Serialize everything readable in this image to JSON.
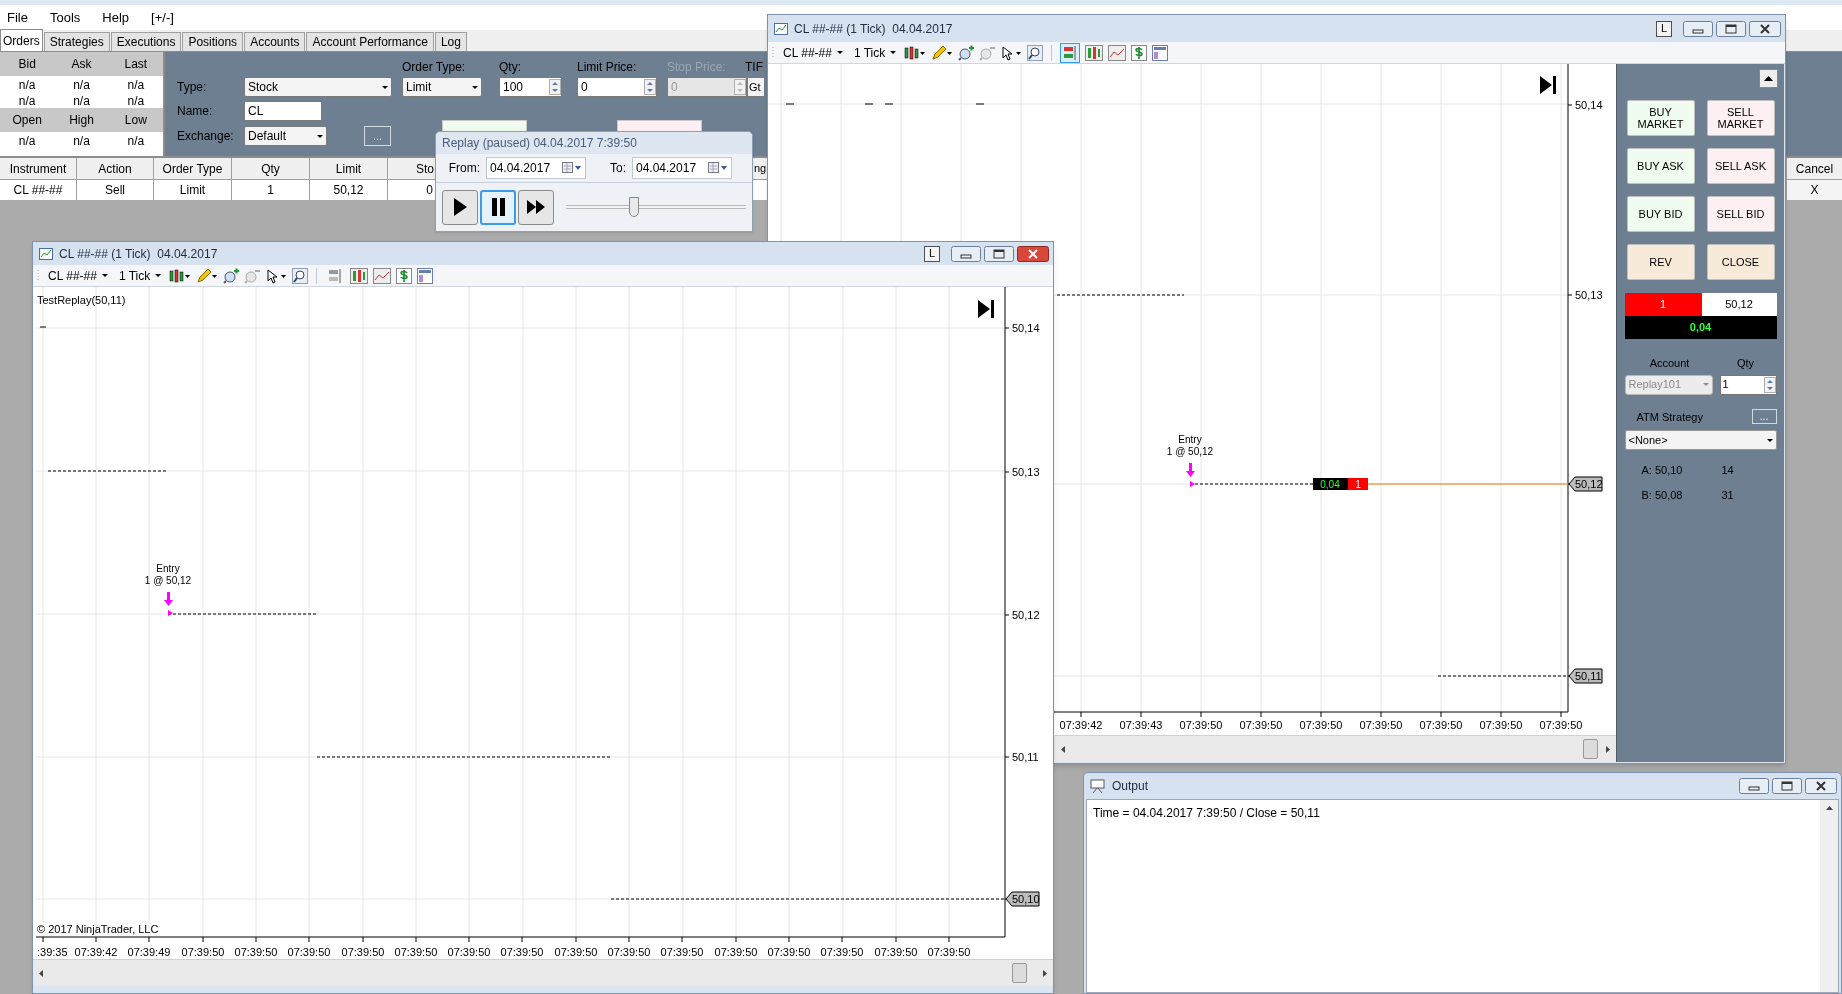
{
  "menu": [
    {
      "label": "File"
    },
    {
      "label": "Tools"
    },
    {
      "label": "Help"
    },
    {
      "label": "[+/-]"
    }
  ],
  "control_center": {
    "tabs": [
      {
        "label": "Orders",
        "selected": true
      },
      {
        "label": "Strategies",
        "selected": false
      },
      {
        "label": "Executions",
        "selected": false
      },
      {
        "label": "Positions",
        "selected": false
      },
      {
        "label": "Accounts",
        "selected": false
      },
      {
        "label": "Account Performance",
        "selected": false
      },
      {
        "label": "Log",
        "selected": false
      }
    ],
    "quotes": [
      {
        "kind": "header",
        "cells": [
          "Bid",
          "Ask",
          "Last"
        ]
      },
      {
        "kind": "values",
        "cells": [
          "n/a",
          "n/a",
          "n/a"
        ]
      },
      {
        "kind": "values",
        "cells": [
          "n/a",
          "n/a",
          "n/a"
        ]
      },
      {
        "kind": "header",
        "cells": [
          "Open",
          "High",
          "Low"
        ]
      },
      {
        "kind": "values",
        "cells": [
          "n/a",
          "n/a",
          "n/a"
        ]
      }
    ],
    "order_entry": {
      "type_label": "Type:",
      "type": "Stock",
      "name_label": "Name:",
      "name": "CL",
      "exchange_label": "Exchange:",
      "exchange": "Default",
      "more_button": "...",
      "order_type_label": "Order Type:",
      "order_type": "Limit",
      "qty_label": "Qty:",
      "qty": "100",
      "limit_price_label": "Limit Price:",
      "limit_price": "0",
      "stop_price_label": "Stop Price:",
      "stop_price": "0",
      "stop_price_disabled": true,
      "tif_label": "TIF",
      "tif": "Gt"
    },
    "orders_table": {
      "columns": [
        "Instrument",
        "Action",
        "Order Type",
        "Qty",
        "Limit",
        "Sto"
      ],
      "rows": [
        {
          "cells": [
            "CL ##-##",
            "Sell",
            "Limit",
            "1",
            "50,12",
            "0"
          ]
        }
      ],
      "column_partial": "ng",
      "cancel_column": {
        "header": "Cancel",
        "cell": "X"
      }
    }
  },
  "replay": {
    "title": "Replay (paused) 04.04.2017 7:39:50",
    "from_label": "From:",
    "from": "04.04.2017",
    "to_label": "To:",
    "to": "04.04.2017",
    "controls": [
      {
        "kind": "play",
        "selected": false
      },
      {
        "kind": "pause",
        "selected": true
      },
      {
        "kind": "fast_forward",
        "selected": false
      }
    ],
    "level": 0.38
  },
  "charts": [
    {
      "title": "CL ##-## (1 Tick)  04.04.2017",
      "lock_button": "L",
      "active": false,
      "instrument": "CL ##-##",
      "interval": "1 Tick",
      "chart_trader_selected": true,
      "price_labels": [
        {
          "text": "50,14",
          "kind": "plain"
        },
        {
          "text": "50,13",
          "kind": "plain"
        },
        {
          "text": "50,12",
          "kind": "marker"
        },
        {
          "text": "50,11",
          "kind": "marker"
        }
      ],
      "time_labels": [
        "07:39:42",
        "07:39:43",
        "07:39:50",
        "07:39:50",
        "07:39:50",
        "07:39:50",
        "07:39:50",
        "07:39:50",
        "07:39:50"
      ],
      "entry": {
        "label": "Entry",
        "detail": "1 @ 50,12"
      },
      "position_tag": {
        "pnl": "0,04",
        "qty": "1"
      },
      "chart_trader": {
        "buttons": [
          {
            "label": "BUY MARKET",
            "kind": "buy"
          },
          {
            "label": "SELL MARKET",
            "kind": "sell"
          },
          {
            "label": "BUY ASK",
            "kind": "buy"
          },
          {
            "label": "SELL ASK",
            "kind": "sell"
          },
          {
            "label": "BUY BID",
            "kind": "buy"
          },
          {
            "label": "SELL BID",
            "kind": "sell"
          },
          {
            "label": "REV",
            "kind": "neutral"
          },
          {
            "label": "CLOSE",
            "kind": "neutral"
          }
        ],
        "position": {
          "qty": "1",
          "avg_price": "50,12",
          "pnl": "0,04"
        },
        "account_label": "Account",
        "account": "Replay101",
        "account_disabled": true,
        "qty_label": "Qty",
        "qty": "1",
        "atm_label": "ATM Strategy",
        "atm_more": "...",
        "atm_strategy": "<None>",
        "quotes": [
          {
            "price": "A: 50,10",
            "size": "14"
          },
          {
            "price": "B: 50,08",
            "size": "31"
          }
        ]
      }
    },
    {
      "title": "CL ##-## (1 Tick)  04.04.2017",
      "lock_button": "L",
      "active": true,
      "instrument": "CL ##-##",
      "interval": "1 Tick",
      "chart_trader_selected": false,
      "indicator": "TestReplay(50,11)",
      "price_labels": [
        {
          "text": "50,14",
          "kind": "plain"
        },
        {
          "text": "50,13",
          "kind": "plain"
        },
        {
          "text": "50,12",
          "kind": "plain"
        },
        {
          "text": "50,11",
          "kind": "plain"
        },
        {
          "text": "50,10",
          "kind": "marker"
        }
      ],
      "time_labels": [
        ":39:35",
        "07:39:42",
        "07:39:49",
        "07:39:50",
        "07:39:50",
        "07:39:50",
        "07:39:50",
        "07:39:50",
        "07:39:50",
        "07:39:50",
        "07:39:50",
        "07:39:50",
        "07:39:50",
        "07:39:50",
        "07:39:50",
        "07:39:50",
        "07:39:50",
        "07:39:50"
      ],
      "entry": {
        "label": "Entry",
        "detail": "1 @ 50,12"
      },
      "copyright": "© 2017 NinjaTrader, LLC"
    }
  ],
  "output": {
    "title": "Output",
    "lines": [
      "Time = 04.04.2017 7:39:50 / Close = 50,11"
    ]
  }
}
